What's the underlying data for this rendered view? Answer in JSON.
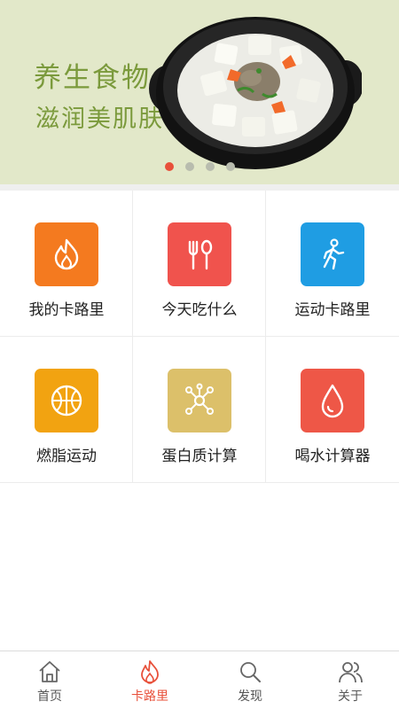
{
  "banner": {
    "line1": "养生食物",
    "line2": "滋润美肌肤",
    "dots": 4,
    "active_dot": 0
  },
  "grid": {
    "items": [
      {
        "label": "我的卡路里",
        "icon": "flame-icon",
        "color": "#f47a1f"
      },
      {
        "label": "今天吃什么",
        "icon": "fork-spoon-icon",
        "color": "#f0534d"
      },
      {
        "label": "运动卡路里",
        "icon": "walking-icon",
        "color": "#1f9de3"
      },
      {
        "label": "燃脂运动",
        "icon": "basketball-icon",
        "color": "#f2a311"
      },
      {
        "label": "蛋白质计算",
        "icon": "molecule-icon",
        "color": "#dcc06a"
      },
      {
        "label": "喝水计算器",
        "icon": "water-drop-icon",
        "color": "#ee5747"
      }
    ]
  },
  "tabbar": {
    "items": [
      {
        "label": "首页",
        "icon": "home-icon"
      },
      {
        "label": "卡路里",
        "icon": "flame-icon"
      },
      {
        "label": "发现",
        "icon": "search-icon"
      },
      {
        "label": "关于",
        "icon": "people-icon"
      }
    ],
    "active_index": 1,
    "active_color": "#e8503a",
    "inactive_color": "#555555"
  }
}
